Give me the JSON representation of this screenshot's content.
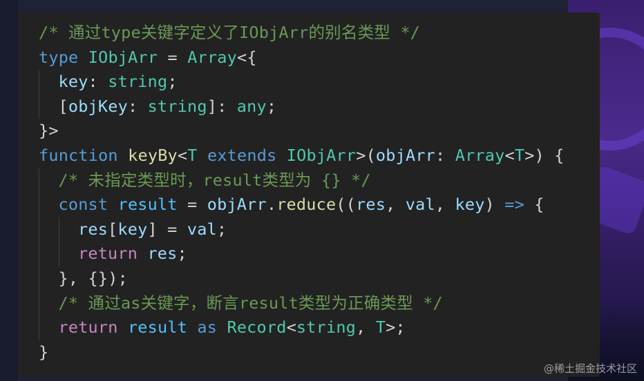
{
  "code": {
    "lines": [
      {
        "indent": 0,
        "tokens": [
          {
            "t": "/* 通过type关键字定义了IObjArr的别名类型 */",
            "c": "comment"
          }
        ]
      },
      {
        "indent": 0,
        "tokens": [
          {
            "t": "type",
            "c": "keyword"
          },
          {
            "t": " ",
            "c": "punc"
          },
          {
            "t": "IObjArr",
            "c": "type"
          },
          {
            "t": " = ",
            "c": "punc"
          },
          {
            "t": "Array",
            "c": "type"
          },
          {
            "t": "<{",
            "c": "punc"
          }
        ]
      },
      {
        "indent": 1,
        "tokens": [
          {
            "t": "key",
            "c": "var"
          },
          {
            "t": ": ",
            "c": "punc"
          },
          {
            "t": "string",
            "c": "type"
          },
          {
            "t": ";",
            "c": "punc"
          }
        ]
      },
      {
        "indent": 1,
        "tokens": [
          {
            "t": "[",
            "c": "punc"
          },
          {
            "t": "objKey",
            "c": "var"
          },
          {
            "t": ": ",
            "c": "punc"
          },
          {
            "t": "string",
            "c": "type"
          },
          {
            "t": "]: ",
            "c": "punc"
          },
          {
            "t": "any",
            "c": "type"
          },
          {
            "t": ";",
            "c": "punc"
          }
        ]
      },
      {
        "indent": 0,
        "tokens": [
          {
            "t": "}>",
            "c": "punc"
          }
        ]
      },
      {
        "indent": 0,
        "tokens": [
          {
            "t": "function",
            "c": "keyword"
          },
          {
            "t": " ",
            "c": "punc"
          },
          {
            "t": "keyBy",
            "c": "func"
          },
          {
            "t": "<",
            "c": "punc"
          },
          {
            "t": "T",
            "c": "type"
          },
          {
            "t": " ",
            "c": "punc"
          },
          {
            "t": "extends",
            "c": "keyword"
          },
          {
            "t": " ",
            "c": "punc"
          },
          {
            "t": "IObjArr",
            "c": "type"
          },
          {
            "t": ">(",
            "c": "punc"
          },
          {
            "t": "objArr",
            "c": "var"
          },
          {
            "t": ": ",
            "c": "punc"
          },
          {
            "t": "Array",
            "c": "type"
          },
          {
            "t": "<",
            "c": "punc"
          },
          {
            "t": "T",
            "c": "type"
          },
          {
            "t": ">) {",
            "c": "punc"
          }
        ]
      },
      {
        "indent": 1,
        "tokens": [
          {
            "t": "/* 未指定类型时，result类型为 {} */",
            "c": "comment"
          }
        ]
      },
      {
        "indent": 1,
        "tokens": [
          {
            "t": "const",
            "c": "keyword"
          },
          {
            "t": " ",
            "c": "punc"
          },
          {
            "t": "result",
            "c": "const"
          },
          {
            "t": " = ",
            "c": "punc"
          },
          {
            "t": "objArr",
            "c": "var"
          },
          {
            "t": ".",
            "c": "punc"
          },
          {
            "t": "reduce",
            "c": "func"
          },
          {
            "t": "((",
            "c": "punc"
          },
          {
            "t": "res",
            "c": "var"
          },
          {
            "t": ", ",
            "c": "punc"
          },
          {
            "t": "val",
            "c": "var"
          },
          {
            "t": ", ",
            "c": "punc"
          },
          {
            "t": "key",
            "c": "var"
          },
          {
            "t": ") ",
            "c": "punc"
          },
          {
            "t": "=>",
            "c": "keyword"
          },
          {
            "t": " {",
            "c": "punc"
          }
        ]
      },
      {
        "indent": 2,
        "tokens": [
          {
            "t": "res",
            "c": "var"
          },
          {
            "t": "[",
            "c": "punc"
          },
          {
            "t": "key",
            "c": "var"
          },
          {
            "t": "] = ",
            "c": "punc"
          },
          {
            "t": "val",
            "c": "var"
          },
          {
            "t": ";",
            "c": "punc"
          }
        ]
      },
      {
        "indent": 2,
        "tokens": [
          {
            "t": "return",
            "c": "control"
          },
          {
            "t": " ",
            "c": "punc"
          },
          {
            "t": "res",
            "c": "var"
          },
          {
            "t": ";",
            "c": "punc"
          }
        ]
      },
      {
        "indent": 1,
        "tokens": [
          {
            "t": "}, {});",
            "c": "punc"
          }
        ]
      },
      {
        "indent": 1,
        "tokens": [
          {
            "t": "/* 通过as关键字，断言result类型为正确类型 */",
            "c": "comment"
          }
        ]
      },
      {
        "indent": 1,
        "tokens": [
          {
            "t": "return",
            "c": "control"
          },
          {
            "t": " ",
            "c": "punc"
          },
          {
            "t": "result",
            "c": "const"
          },
          {
            "t": " ",
            "c": "punc"
          },
          {
            "t": "as",
            "c": "keyword"
          },
          {
            "t": " ",
            "c": "punc"
          },
          {
            "t": "Record",
            "c": "type"
          },
          {
            "t": "<",
            "c": "punc"
          },
          {
            "t": "string",
            "c": "type"
          },
          {
            "t": ", ",
            "c": "punc"
          },
          {
            "t": "T",
            "c": "type"
          },
          {
            "t": ">;",
            "c": "punc"
          }
        ]
      },
      {
        "indent": 0,
        "tokens": [
          {
            "t": "}",
            "c": "punc"
          }
        ]
      }
    ]
  },
  "watermark": "@稀土掘金技术社区",
  "colors": {
    "comment": "#6a9955",
    "keyword": "#569cd6",
    "type": "#4ec9b0",
    "var": "#9cdcfe",
    "func": "#dcdcaa",
    "control": "#c586c0",
    "const": "#4fc1ff",
    "punc": "#d4d4d4"
  }
}
